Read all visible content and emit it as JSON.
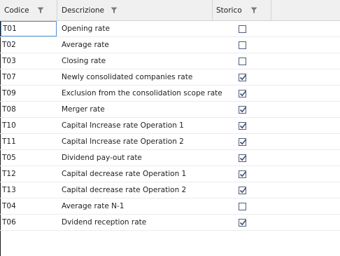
{
  "grid": {
    "columns": {
      "code": "Codice",
      "description": "Descrizione",
      "historical": "Storico"
    },
    "rows": [
      {
        "code": "T01",
        "description": "Opening rate",
        "historical": false
      },
      {
        "code": "T02",
        "description": "Average rate",
        "historical": false
      },
      {
        "code": "T03",
        "description": "Closing rate",
        "historical": false
      },
      {
        "code": "T07",
        "description": "Newly consolidated companies rate",
        "historical": true
      },
      {
        "code": "T09",
        "description": "Exclusion from the consolidation scope rate",
        "historical": true
      },
      {
        "code": "T08",
        "description": "Merger rate",
        "historical": true
      },
      {
        "code": "T10",
        "description": "Capital Increase rate Operation 1",
        "historical": true
      },
      {
        "code": "T11",
        "description": "Capital Increase rate Operation 2",
        "historical": true
      },
      {
        "code": "T05",
        "description": "Dividend pay-out rate",
        "historical": true
      },
      {
        "code": "T12",
        "description": "Capital decrease rate Operation 1",
        "historical": true
      },
      {
        "code": "T13",
        "description": "Capital decrease rate Operation 2",
        "historical": true
      },
      {
        "code": "T04",
        "description": "Average rate N-1",
        "historical": false
      },
      {
        "code": "T06",
        "description": "Dvidend reception rate",
        "historical": true
      }
    ]
  },
  "colors": {
    "header_bg": "#f0f0f0",
    "checkbox_border": "#4d5f79",
    "check_mark": "#3a4f6d",
    "focus_border": "#4a90d9"
  },
  "icons": {
    "filter": "funnel-icon",
    "checked": "checkmark-icon"
  }
}
